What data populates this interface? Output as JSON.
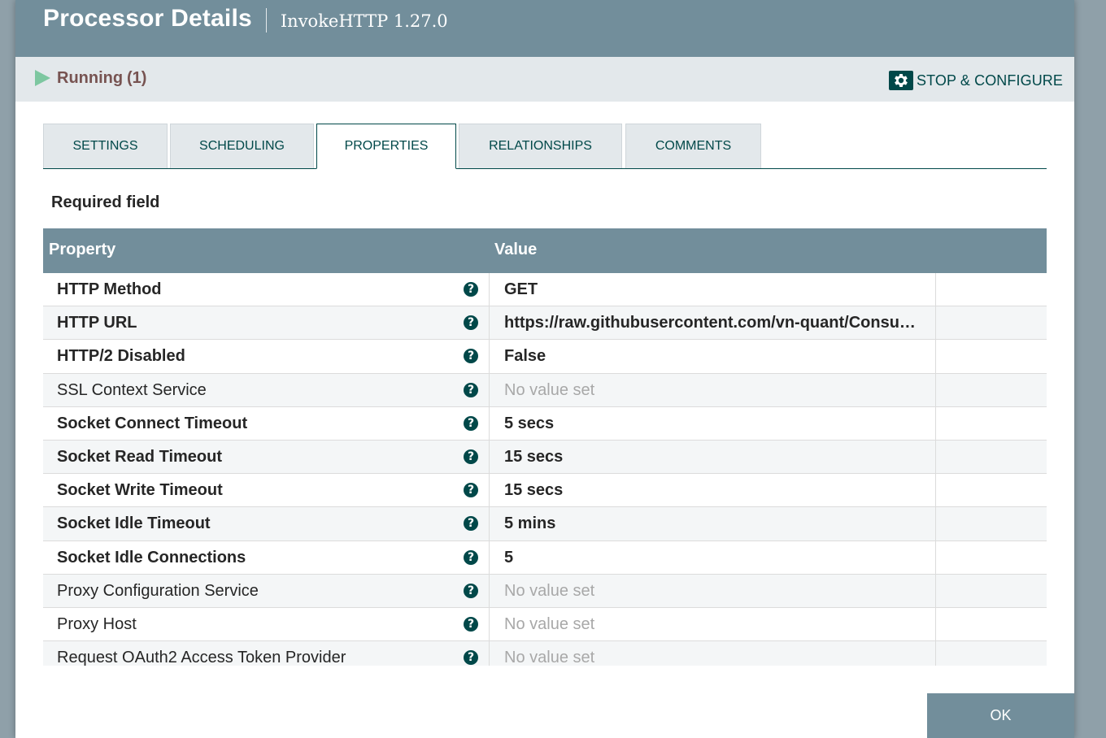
{
  "dialog": {
    "title": "Processor Details",
    "subtitle": "InvokeHTTP 1.27.0"
  },
  "status": {
    "state": "Running",
    "count": "(1)",
    "state_icon": "play-icon",
    "state_color": "#7dc7a0",
    "action_label": "STOP & CONFIGURE",
    "action_icon": "gear-icon"
  },
  "tabs": [
    {
      "label": "SETTINGS",
      "active": false
    },
    {
      "label": "SCHEDULING",
      "active": false
    },
    {
      "label": "PROPERTIES",
      "active": true
    },
    {
      "label": "RELATIONSHIPS",
      "active": false
    },
    {
      "label": "COMMENTS",
      "active": false
    }
  ],
  "required_note": "Required field",
  "grid": {
    "headers": {
      "property": "Property",
      "value": "Value"
    },
    "rows": [
      {
        "name": "HTTP Method",
        "required": true,
        "value": "GET",
        "unset": false
      },
      {
        "name": "HTTP URL",
        "required": true,
        "value": "https://raw.githubusercontent.com/vn-quant/Consum...",
        "unset": false
      },
      {
        "name": "HTTP/2 Disabled",
        "required": true,
        "value": "False",
        "unset": false
      },
      {
        "name": "SSL Context Service",
        "required": false,
        "value": "No value set",
        "unset": true
      },
      {
        "name": "Socket Connect Timeout",
        "required": true,
        "value": "5 secs",
        "unset": false
      },
      {
        "name": "Socket Read Timeout",
        "required": true,
        "value": "15 secs",
        "unset": false
      },
      {
        "name": "Socket Write Timeout",
        "required": true,
        "value": "15 secs",
        "unset": false
      },
      {
        "name": "Socket Idle Timeout",
        "required": true,
        "value": "5 mins",
        "unset": false
      },
      {
        "name": "Socket Idle Connections",
        "required": true,
        "value": "5",
        "unset": false
      },
      {
        "name": "Proxy Configuration Service",
        "required": false,
        "value": "No value set",
        "unset": true
      },
      {
        "name": "Proxy Host",
        "required": false,
        "value": "No value set",
        "unset": true
      },
      {
        "name": "Request OAuth2 Access Token Provider",
        "required": false,
        "value": "No value set",
        "unset": true
      }
    ],
    "help_icon": "question-circle-icon"
  },
  "footer": {
    "ok_label": "OK"
  },
  "colors": {
    "header_bg": "#728e9b",
    "accent": "#004849",
    "status_text": "#775351"
  }
}
